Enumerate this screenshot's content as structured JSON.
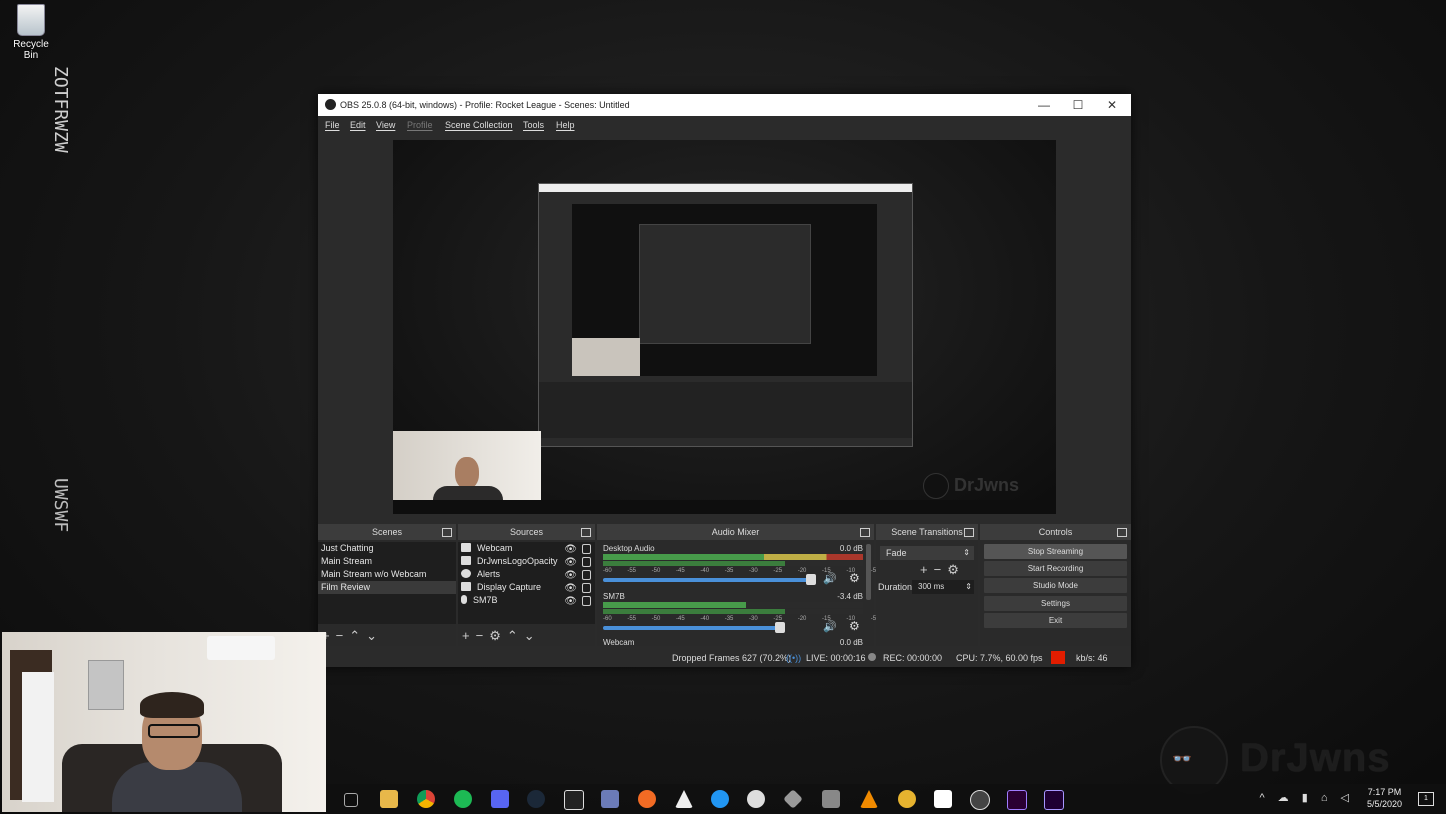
{
  "desktop": {
    "recycle_bin_label": "Recycle Bin",
    "side_text_top": "ZOTFRWZW",
    "side_text_bottom": "UWSWF"
  },
  "watermark": {
    "text": "DrJwns"
  },
  "obs": {
    "title": "OBS 25.0.8 (64-bit, windows) - Profile: Rocket League - Scenes: Untitled",
    "menu": [
      "File",
      "Edit",
      "View",
      "Profile",
      "Scene Collection",
      "Tools",
      "Help"
    ],
    "scenes": {
      "title": "Scenes",
      "items": [
        "Just Chatting",
        "Main Stream",
        "Main Stream w/o Webcam",
        "Film Review"
      ],
      "selected": "Film Review"
    },
    "sources": {
      "title": "Sources",
      "items": [
        "Webcam",
        "DrJwnsLogoOpacity",
        "Alerts",
        "Display Capture",
        "SM7B"
      ]
    },
    "audio_mixer": {
      "title": "Audio Mixer",
      "channels": [
        {
          "name": "Desktop Audio",
          "db": "0.0 dB",
          "level": 0.92
        },
        {
          "name": "SM7B",
          "db": "-3.4 dB",
          "level": 0.68
        },
        {
          "name": "Webcam",
          "db": "0.0 dB",
          "level": 0.92
        }
      ],
      "scale": "-60 -55 -50 -45 -40 -35 -30 -25 -20 -15 -10 -5 0"
    },
    "scene_transitions": {
      "title": "Scene Transitions",
      "transition": "Fade",
      "duration_label": "Duration",
      "duration_value": "300 ms"
    },
    "controls": {
      "title": "Controls",
      "buttons": [
        "Stop Streaming",
        "Start Recording",
        "Studio Mode",
        "Settings",
        "Exit"
      ]
    },
    "status": {
      "dropped": "Dropped Frames 627 (70.2%)",
      "live": "LIVE: 00:00:16",
      "rec": "REC: 00:00:00",
      "cpu": "CPU: 7.7%, 60.00 fps",
      "kbps": "kb/s: 46"
    }
  },
  "taskbar": {
    "time": "7:17 PM",
    "date": "5/5/2020",
    "notification_count": "1"
  },
  "colors": {
    "obs_bg": "#2b2b2b",
    "meter_green": "#4caf50",
    "meter_yellow": "#d9c54a",
    "meter_red": "#c0392b",
    "fader_blue": "#4a90d9",
    "status_red": "#e11d00"
  }
}
